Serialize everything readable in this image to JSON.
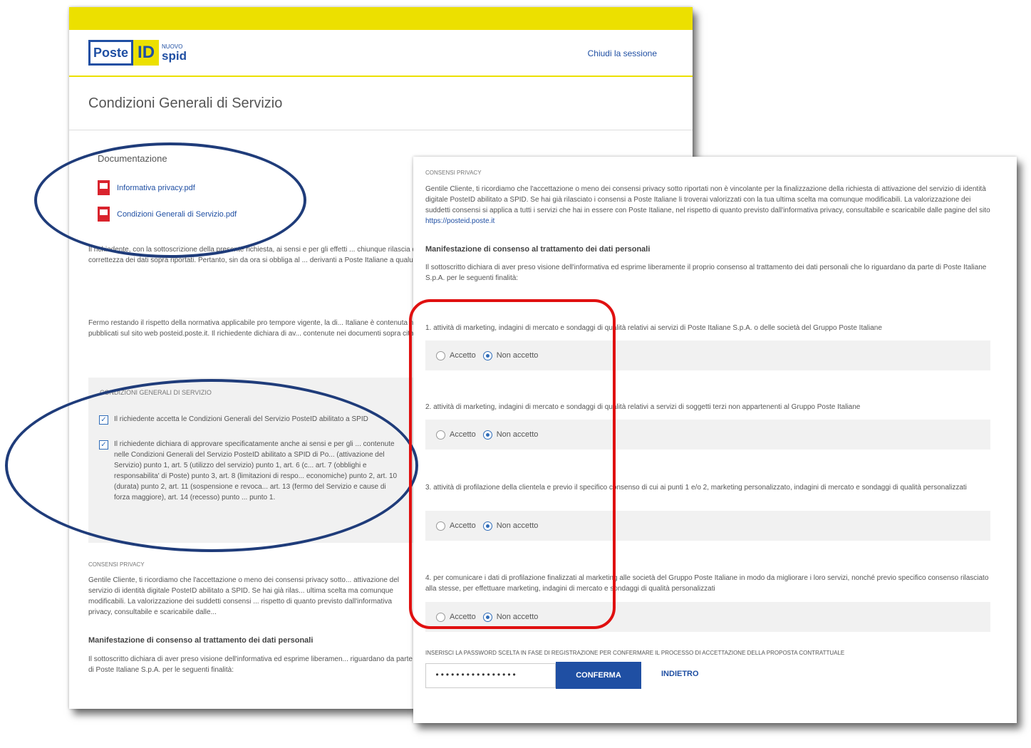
{
  "app": {
    "logo": {
      "poste": "Poste",
      "id": "ID",
      "nuovo": "NUOVO",
      "spid": "spid"
    },
    "logout_link": "Chiudi la sessione",
    "page_title": "Condizioni Generali di Servizio"
  },
  "documents": {
    "title": "Documentazione",
    "items": [
      {
        "label": "Informativa privacy.pdf",
        "icon": "pdf-icon"
      },
      {
        "label": "Condizioni Generali di Servizio.pdf",
        "icon": "pdf-icon"
      }
    ]
  },
  "declaration": {
    "para1": "Il richiedente, con la sottoscrizione della presente richiesta, ai sensi e per gli effetti ... chiunque rilascia dichiarazioni mendaci è punito ai sensi del codice penale e delle ... veridicità e la correttezza dei dati sopra riportati. Pertanto, sin da ora si obbliga al ... derivanti a Poste Italiane a qualunque titolo in relazione alla presente richiesta di ... nelle Tabelle I, II e III.",
    "para2": "Fermo restando il rispetto della normativa applicabile pro tempore vigente, la di... Italiane è contenuta nelle Condizioni Generali del Servizio PosteID abilitato a SPID... Poste Italiane pubblicati sul sito web posteid.poste.it. Il richiedente dichiara di av... contenute nei documenti sopra citati come di seguito specificato:"
  },
  "general_conditions": {
    "title": "CONDIZIONI GENERALI DI SERVIZIO",
    "items": [
      {
        "checked": true,
        "label": "Il richiedente accetta le Condizioni Generali del Servizio PosteID abilitato a SPID"
      },
      {
        "checked": true,
        "label": "Il richiedente dichiara di approvare specificatamente anche ai sensi e per gli ... contenute nelle Condizioni Generali del Servizio PosteID abilitato a SPID di Po... (attivazione del Servizio) punto 1, art. 5 (utilizzo del servizio) punto 1, art. 6 (c... art. 7 (obblighi e responsabilita' di Poste) punto 3, art. 8 (limitazioni di respo... economiche) punto 2, art. 10 (durata) punto 2, art. 11 (sospensione e revoca... art. 13 (fermo del Servizio e cause di forza maggiore), art. 14 (recesso) punto ... punto 1."
      }
    ]
  },
  "privacy_bg": {
    "label": "CONSENSI PRIVACY",
    "text": "Gentile Cliente, ti ricordiamo che l'accettazione o meno dei consensi privacy sotto... attivazione del servizio di identità digitale PosteID abilitato a SPID. Se hai già rilas... ultima scelta ma comunque modificabili. La valorizzazione dei suddetti consensi ... rispetto di quanto previsto dall'informativa privacy, consultabile e scaricabile dalle...",
    "heading": "Manifestazione di consenso al trattamento dei dati personali",
    "intro": "Il sottoscritto dichiara di aver preso visione dell'informativa ed esprime liberamen... riguardano da parte di Poste Italiane S.p.A. per le seguenti finalità:"
  },
  "privacy": {
    "label": "CONSENSI PRIVACY",
    "text_before_link": "Gentile Cliente, ti ricordiamo che l'accettazione o meno dei consensi privacy sotto riportati non è vincolante per la finalizzazione della richiesta di attivazione del servizio di identità digitale PosteID abilitato a SPID. Se hai già rilasciato i consensi a Poste Italiane li troverai valorizzati con la tua ultima scelta ma comunque modificabili. La valorizzazione dei suddetti consensi si applica a tutti i servizi che hai in essere con Poste Italiane, nel rispetto di quanto previsto dall'informativa privacy, consultabile e scaricabile dalle pagine del sito ",
    "link": "https://posteid.poste.it",
    "heading": "Manifestazione di consenso al trattamento dei dati personali",
    "intro": "Il sottoscritto dichiara di aver preso visione dell'informativa ed esprime liberamente il proprio consenso al trattamento dei dati personali che lo riguardano da parte di Poste Italiane S.p.A. per le seguenti finalità:",
    "accept_label": "Accetto",
    "reject_label": "Non accetto",
    "consents": [
      {
        "text": "1. attività di marketing, indagini di mercato e sondaggi di qualità relativi ai servizi di Poste Italiane S.p.A. o delle società del Gruppo Poste Italiane",
        "selected": "Non accetto"
      },
      {
        "text": "2. attività di marketing, indagini di mercato e sondaggi di qualità relativi a servizi di soggetti terzi non appartenenti al Gruppo Poste Italiane",
        "selected": "Non accetto"
      },
      {
        "text": "3. attività di profilazione della clientela e previo il specifico consenso di cui ai punti 1 e/o 2, marketing personalizzato, indagini di mercato e sondaggi di qualità personalizzati",
        "selected": "Non accetto"
      },
      {
        "text": "4. per comunicare i dati di profilazione finalizzati al marketing alle società del Gruppo Poste Italiane in modo da migliorare i loro servizi, nonché previo specifico consenso rilasciato alla stesse, per effettuare marketing, indagini di mercato e sondaggi di qualità personalizzati",
        "selected": "Non accetto"
      }
    ]
  },
  "confirm": {
    "label": "INSERISCI LA PASSWORD SCELTA IN FASE DI REGISTRAZIONE PER CONFERMARE IL PROCESSO DI ACCETTAZIONE DELLA PROPOSTA CONTRATTUALE",
    "password_value": "••••••••••••••••",
    "confirm_button": "CONFERMA",
    "back_button": "INDIETRO"
  },
  "colors": {
    "yellow": "#ece000",
    "brand_blue": "#1f4fa3",
    "ellipse": "#1f3c7a",
    "highlight_red": "#e01010"
  }
}
